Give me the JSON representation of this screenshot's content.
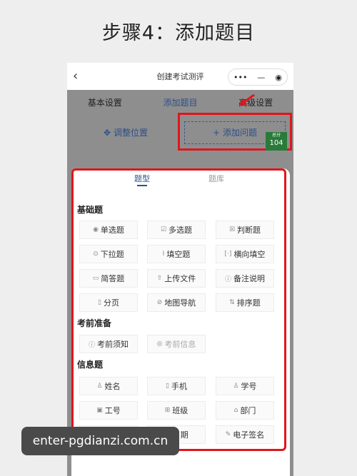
{
  "heading": "步骤4：添加题目",
  "navbar": {
    "back": "‹",
    "title": "创建考试测评",
    "more": "•••",
    "minus": "—",
    "record": "◉"
  },
  "tabs": [
    "基本设置",
    "添加题目",
    "高级设置"
  ],
  "actions": {
    "adjust": "调整位置",
    "adjust_icon": "✥",
    "add": "添加问题",
    "add_icon": "+"
  },
  "score_badge": {
    "label": "总分",
    "value": "104"
  },
  "sheet": {
    "tabs": [
      "题型",
      "题库"
    ],
    "sections": [
      {
        "title": "基础题",
        "items": [
          {
            "icon": "◉",
            "label": "单选题"
          },
          {
            "icon": "☑",
            "label": "多选题"
          },
          {
            "icon": "☒",
            "label": "判断题"
          },
          {
            "icon": "⊙",
            "label": "下拉题"
          },
          {
            "icon": "I",
            "label": "填空题"
          },
          {
            "icon": "[·]",
            "label": "横向填空"
          },
          {
            "icon": "▭",
            "label": "简答题"
          },
          {
            "icon": "⇧",
            "label": "上传文件"
          },
          {
            "icon": "ⓘ",
            "label": "备注说明"
          },
          {
            "icon": "▯",
            "label": "分页"
          },
          {
            "icon": "⊘",
            "label": "地图导航"
          },
          {
            "icon": "⇅",
            "label": "排序题"
          }
        ]
      },
      {
        "title": "考前准备",
        "items": [
          {
            "icon": "ⓘ",
            "label": "考前须知"
          },
          {
            "icon": "◎",
            "label": "考前信息",
            "disabled": true
          }
        ]
      },
      {
        "title": "信息题",
        "items": [
          {
            "icon": "♙",
            "label": "姓名"
          },
          {
            "icon": "▯",
            "label": "手机"
          },
          {
            "icon": "♙",
            "label": "学号"
          },
          {
            "icon": "▣",
            "label": "工号"
          },
          {
            "icon": "⊞",
            "label": "班级"
          },
          {
            "icon": "⌂",
            "label": "部门"
          },
          {
            "icon": "♙",
            "label": "性别"
          },
          {
            "icon": "▦",
            "label": "日期"
          },
          {
            "icon": "✎",
            "label": "电子签名"
          }
        ]
      }
    ]
  },
  "watermark": "enter-pgdianzi.com.cn"
}
